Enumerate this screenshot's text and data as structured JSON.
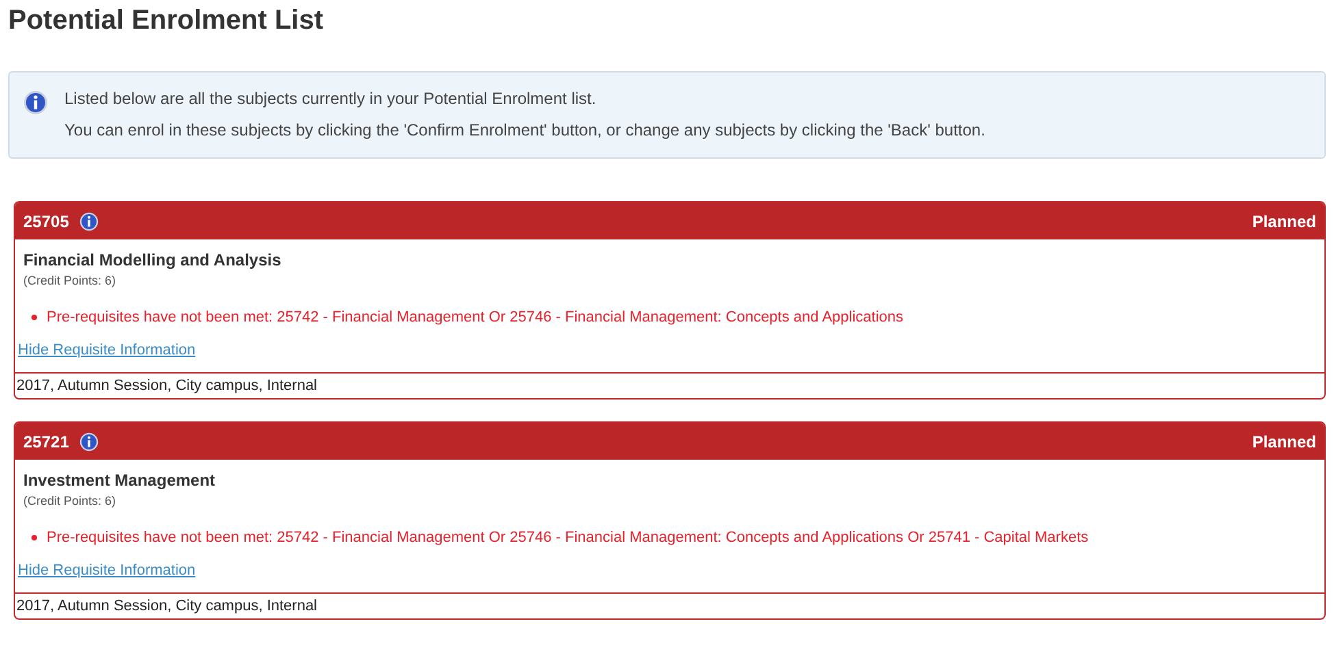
{
  "page_title": "Potential Enrolment List",
  "info_box": {
    "lines": [
      "Listed below are all the subjects currently in your Potential Enrolment list.",
      "You can enrol in these subjects by clicking the 'Confirm Enrolment' button, or change any subjects by clicking the 'Back' button."
    ]
  },
  "subjects": [
    {
      "code": "25705",
      "status": "Planned",
      "name": "Financial Modelling and Analysis",
      "credit_points": "(Credit Points: 6)",
      "requisites": [
        "Pre-requisites have not been met: 25742 - Financial Management Or 25746 - Financial Management: Concepts and Applications"
      ],
      "requisite_link": "Hide Requisite Information",
      "offering": "2017, Autumn Session, City campus, Internal"
    },
    {
      "code": "25721",
      "status": "Planned",
      "name": "Investment Management",
      "credit_points": "(Credit Points: 6)",
      "requisites": [
        "Pre-requisites have not been met: 25742 - Financial Management Or 25746 - Financial Management: Concepts and Applications Or 25741 - Capital Markets"
      ],
      "requisite_link": "Hide Requisite Information",
      "offering": "2017, Autumn Session, City campus, Internal"
    }
  ]
}
